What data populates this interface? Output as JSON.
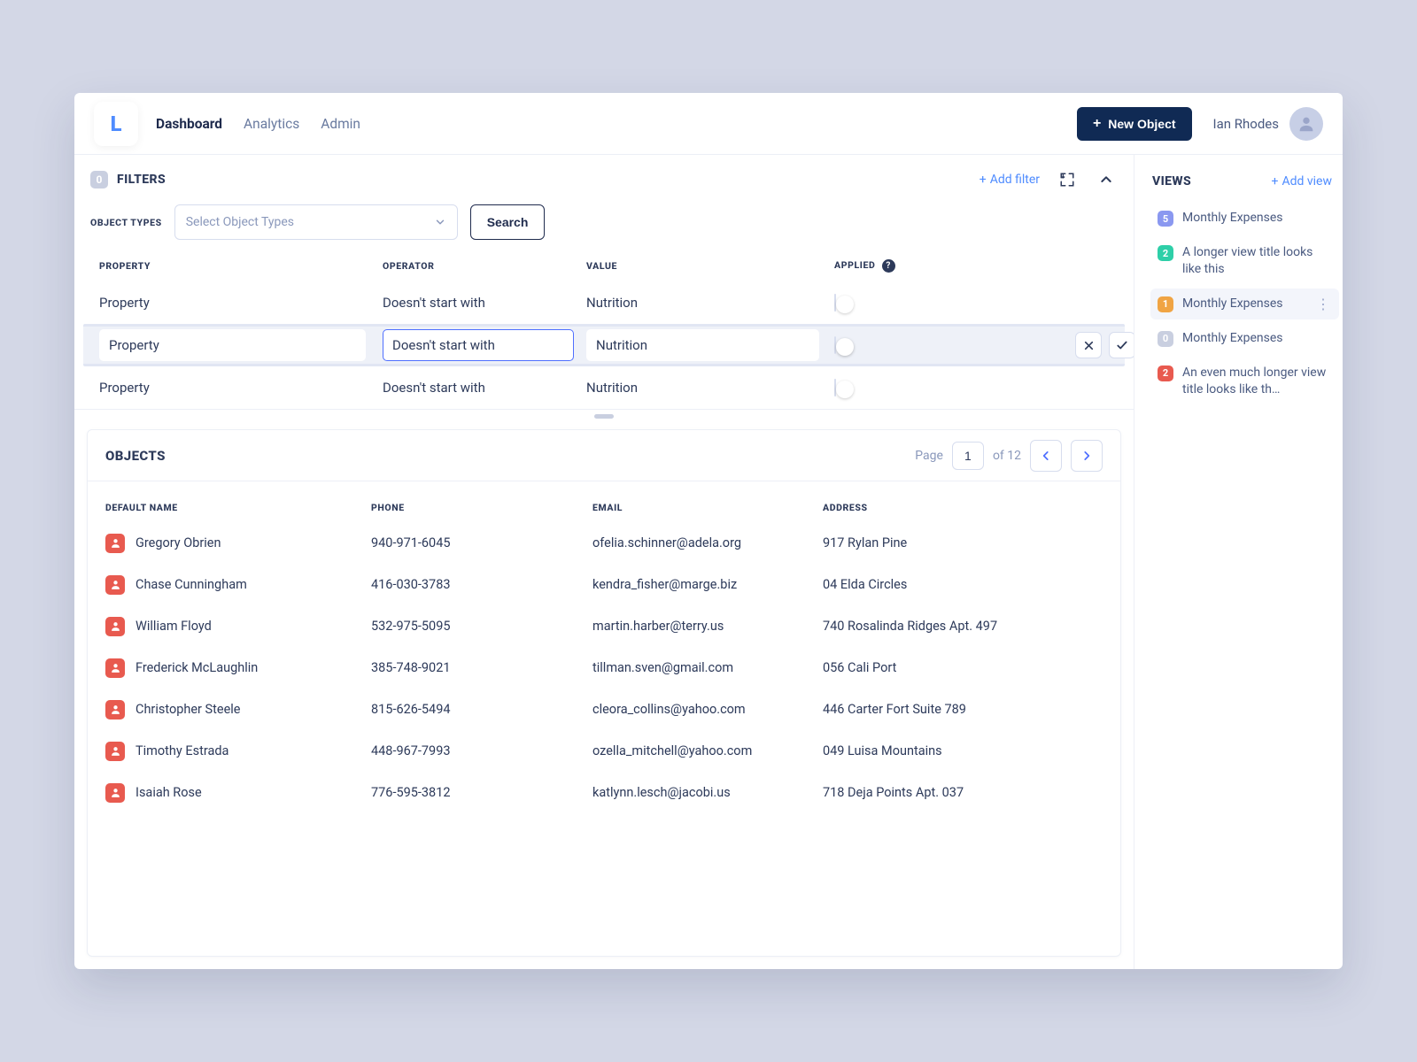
{
  "logo_letter": "L",
  "nav": {
    "dashboard": "Dashboard",
    "analytics": "Analytics",
    "admin": "Admin"
  },
  "new_object_btn": "New Object",
  "user_name": "Ian Rhodes",
  "filters": {
    "count": "0",
    "title": "FILTERS",
    "add_filter": "Add filter",
    "object_types_label": "OBJECT TYPES",
    "object_types_placeholder": "Select Object Types",
    "search_btn": "Search",
    "columns": {
      "property": "PROPERTY",
      "operator": "OPERATOR",
      "value": "VALUE",
      "applied": "APPLIED"
    },
    "rows": [
      {
        "property": "Property",
        "operator": "Doesn't start with",
        "value": "Nutrition"
      },
      {
        "property": "Property",
        "operator": "Doesn't start with",
        "value": "Nutrition"
      },
      {
        "property": "Property",
        "operator": "Doesn't start with",
        "value": "Nutrition"
      }
    ]
  },
  "objects": {
    "title": "OBJECTS",
    "page_label": "Page",
    "page_current": "1",
    "page_of": "of 12",
    "columns": {
      "name": "DEFAULT NAME",
      "phone": "PHONE",
      "email": "EMAIL",
      "address": "ADDRESS"
    },
    "rows": [
      {
        "name": "Gregory Obrien",
        "phone": "940-971-6045",
        "email": "ofelia.schinner@adela.org",
        "address": "917 Rylan Pine"
      },
      {
        "name": "Chase Cunningham",
        "phone": "416-030-3783",
        "email": "kendra_fisher@marge.biz",
        "address": "04 Elda Circles"
      },
      {
        "name": "William Floyd",
        "phone": "532-975-5095",
        "email": "martin.harber@terry.us",
        "address": "740 Rosalinda Ridges Apt. 497"
      },
      {
        "name": "Frederick McLaughlin",
        "phone": "385-748-9021",
        "email": "tillman.sven@gmail.com",
        "address": "056 Cali Port"
      },
      {
        "name": "Christopher Steele",
        "phone": "815-626-5494",
        "email": "cleora_collins@yahoo.com",
        "address": "446 Carter Fort Suite 789"
      },
      {
        "name": "Timothy Estrada",
        "phone": "448-967-7993",
        "email": "ozella_mitchell@yahoo.com",
        "address": "049 Luisa Mountains"
      },
      {
        "name": "Isaiah Rose",
        "phone": "776-595-3812",
        "email": "katlynn.lesch@jacobi.us",
        "address": "718 Deja Points Apt. 037"
      }
    ]
  },
  "views": {
    "title": "VIEWS",
    "add_view": "Add view",
    "items": [
      {
        "count": "5",
        "color": "#8a98f0",
        "label": "Monthly Expenses"
      },
      {
        "count": "2",
        "color": "#2ecfa8",
        "label": "A longer view title looks like this"
      },
      {
        "count": "1",
        "color": "#f0a444",
        "label": "Monthly Expenses",
        "selected": true
      },
      {
        "count": "0",
        "color": "#c9cfe0",
        "label": "Monthly Expenses"
      },
      {
        "count": "2",
        "color": "#e85a4f",
        "label": "An even much longer view title looks like th…"
      }
    ]
  }
}
